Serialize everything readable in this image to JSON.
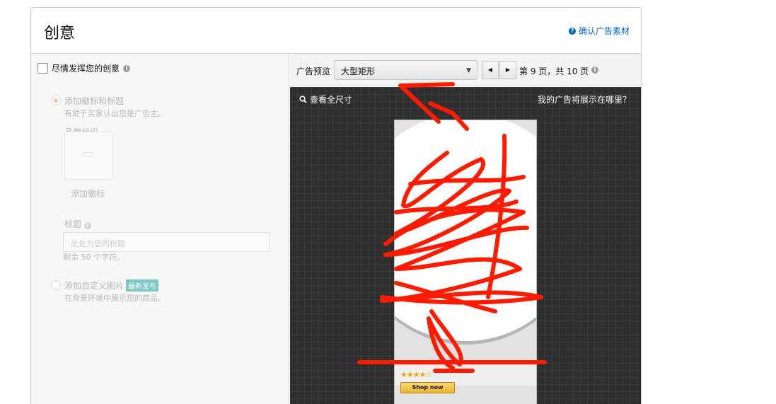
{
  "header": {
    "title": "创意",
    "help_link": "确认广告素材"
  },
  "left": {
    "freeform_label": "尽情发挥您的创意",
    "option1": {
      "label": "添加徽标和标题",
      "description": "有助于买家认出您是广告主。"
    },
    "brand_label": "品牌标识",
    "add_logo": "添加徽标",
    "headline_label": "标题",
    "headline_placeholder": "此处为您的标题",
    "chars_remaining": "剩余 50 个字符。",
    "option2": {
      "label": "添加自定义图片",
      "badge": "最新发布",
      "description": "在背景环境中展示您的商品。"
    }
  },
  "toolbar": {
    "preview_label": "广告预览",
    "size_selected": "大型矩形",
    "page_text": "第 9 页，共 10 页"
  },
  "stage": {
    "view_full": "查看全尺寸",
    "where_shown": "我的广告将展示在哪里？"
  },
  "ad": {
    "cta": "Shop now",
    "stars": "★★★★☆"
  },
  "colors": {
    "link": "#0066c0",
    "scribble": "#ff1a00"
  }
}
